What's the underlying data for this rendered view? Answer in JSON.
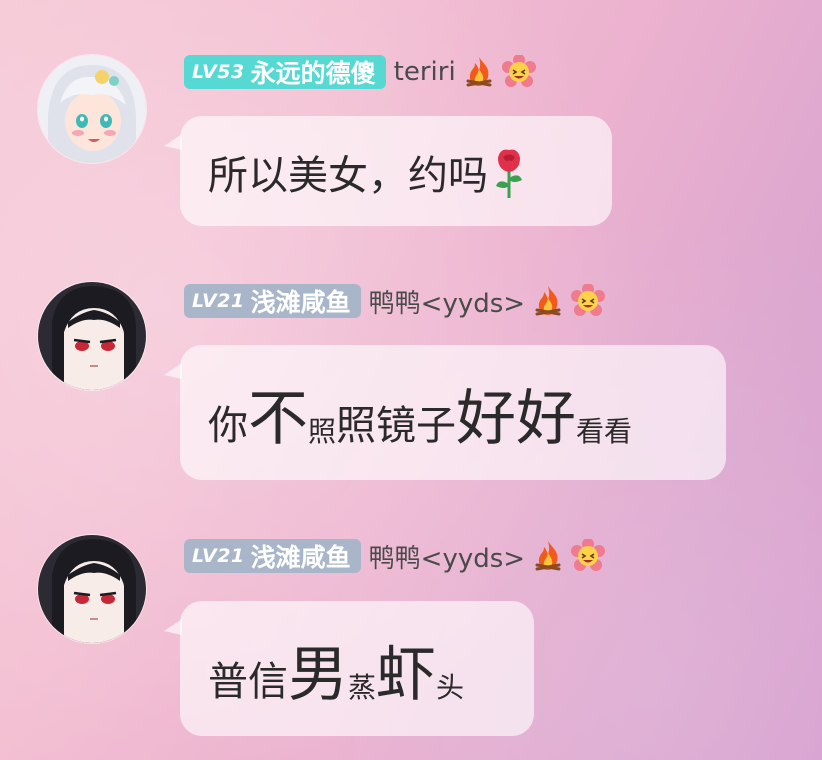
{
  "messages": [
    {
      "avatar": "anime-girl-white-hair-avatar",
      "badge": {
        "level": "LV53",
        "name": "永远的德傻",
        "color": "#56d9d3"
      },
      "nickname": "teriri",
      "text_segments": [
        {
          "text": "所以美女，约吗",
          "size": "m"
        }
      ],
      "trailing_emoji": "rose-icon"
    },
    {
      "avatar": "anime-girl-black-hair-avatar",
      "badge": {
        "level": "LV21",
        "name": "浅滩咸鱼",
        "color": "#a9b6c9"
      },
      "nickname": "鸭鸭<yyds>",
      "text_segments": [
        {
          "text": "你",
          "size": "m"
        },
        {
          "text": "不",
          "size": "l"
        },
        {
          "text": "照",
          "size": "s"
        },
        {
          "text": "照镜子",
          "size": "m"
        },
        {
          "text": "好好",
          "size": "l"
        },
        {
          "text": "看看",
          "size": "s"
        }
      ]
    },
    {
      "avatar": "anime-girl-black-hair-avatar",
      "badge": {
        "level": "LV21",
        "name": "浅滩咸鱼",
        "color": "#a9b6c9"
      },
      "nickname": "鸭鸭<yyds>",
      "text_segments": [
        {
          "text": "普信",
          "size": "m"
        },
        {
          "text": "男",
          "size": "l"
        },
        {
          "text": "蒸",
          "size": "s"
        },
        {
          "text": "虾",
          "size": "l"
        },
        {
          "text": "头",
          "size": "s"
        }
      ]
    }
  ]
}
